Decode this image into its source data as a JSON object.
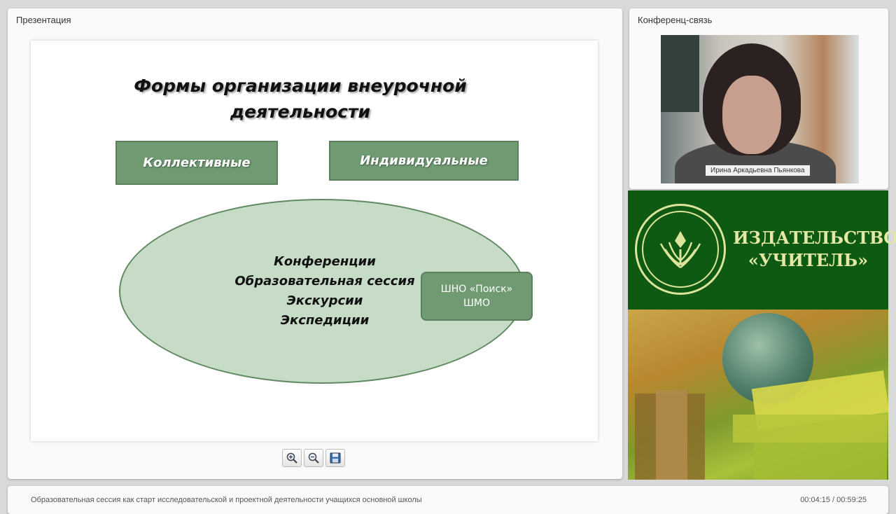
{
  "presentation": {
    "panel_title": "Презентация",
    "slide": {
      "title_line1": "Формы организации внеурочной",
      "title_line2": "деятельности",
      "box_left": "Коллективные",
      "box_right": "Индивидуальные",
      "ellipse_items": [
        "Конференции",
        "Образовательная сессия",
        "Экскурсии",
        "Экспедиции"
      ],
      "shno_line1": "ШНО «Поиск»",
      "shno_line2": "ШМО"
    },
    "toolbar": {
      "zoom_in": "zoom-in-icon",
      "zoom_out": "zoom-out-icon",
      "save": "save-icon"
    }
  },
  "conference": {
    "panel_title": "Конференц-связь",
    "speaker_name": "Ирина Аркадьевна Пьянкова"
  },
  "publisher": {
    "name_line1": "ИЗДАТЕЛЬСТВО",
    "name_line2": "«УЧИТЕЛЬ»",
    "brand_green": "#0f5a12",
    "brand_text": "#e4e8a6"
  },
  "footer": {
    "title": "Образовательная сессия как старт исследовательской и проектной деятельности учащихся основной школы",
    "time": "00:04:15 / 00:59:25"
  },
  "colors": {
    "slide_green": "#6f9a72",
    "ellipse_fill": "#c6dcc7"
  }
}
